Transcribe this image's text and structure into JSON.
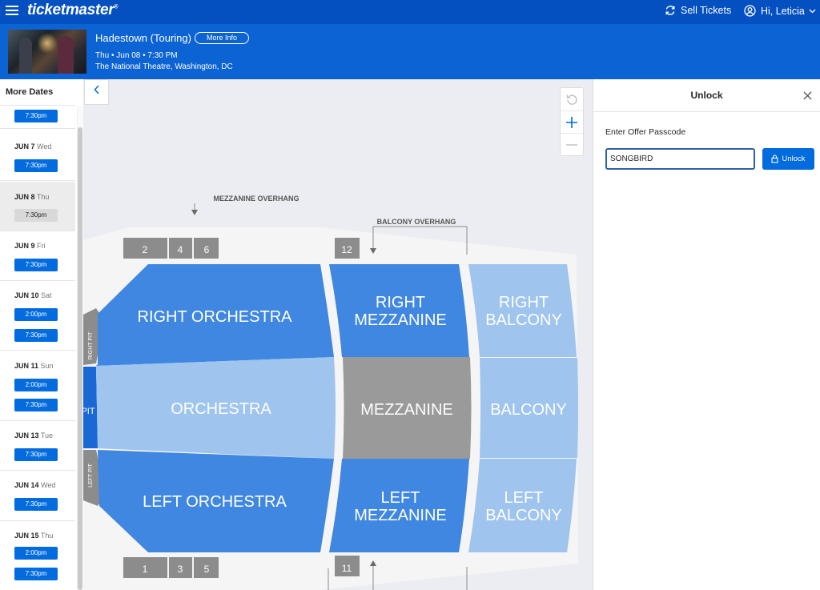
{
  "topbar": {
    "logo": "ticketmaster",
    "sell_tickets": "Sell Tickets",
    "user_greeting": "Hi, Leticia"
  },
  "event": {
    "title": "Hadestown (Touring)",
    "more_info": "More Info",
    "date": "Thu • Jun 08 • 7:30 PM",
    "venue": "The National Theatre, Washington, DC"
  },
  "dates_panel": {
    "title": "More Dates",
    "groups": [
      {
        "date": "",
        "day": "",
        "times": [
          "7:30pm"
        ],
        "selected": false
      },
      {
        "date": "JUN 7",
        "day": "Wed",
        "times": [
          "7:30pm"
        ],
        "selected": false
      },
      {
        "date": "JUN 8",
        "day": "Thu",
        "times": [
          "7:30pm"
        ],
        "selected": true
      },
      {
        "date": "JUN 9",
        "day": "Fri",
        "times": [
          "7:30pm"
        ],
        "selected": false
      },
      {
        "date": "JUN 10",
        "day": "Sat",
        "times": [
          "2:00pm",
          "7:30pm"
        ],
        "selected": false
      },
      {
        "date": "JUN 11",
        "day": "Sun",
        "times": [
          "2:00pm",
          "7:30pm"
        ],
        "selected": false
      },
      {
        "date": "JUN 13",
        "day": "Tue",
        "times": [
          "7:30pm"
        ],
        "selected": false
      },
      {
        "date": "JUN 14",
        "day": "Wed",
        "times": [
          "7:30pm"
        ],
        "selected": false
      },
      {
        "date": "JUN 15",
        "day": "Thu",
        "times": [
          "2:00pm",
          "7:30pm"
        ],
        "selected": false
      }
    ]
  },
  "seatmap": {
    "overhang_mezz": "MEZZANINE OVERHANG",
    "overhang_balc": "BALCONY OVERHANG",
    "boxes_top": [
      "2",
      "4",
      "6"
    ],
    "box_top_single": "12",
    "boxes_bottom": [
      "1",
      "3",
      "5"
    ],
    "box_bottom_single": "11",
    "sections": {
      "right_orchestra": "RIGHT ORCHESTRA",
      "orchestra": "ORCHESTRA",
      "left_orchestra": "LEFT ORCHESTRA",
      "right_mezzanine_1": "RIGHT",
      "right_mezzanine_2": "MEZZANINE",
      "mezzanine": "MEZZANINE",
      "left_mezzanine_1": "LEFT",
      "left_mezzanine_2": "MEZZANINE",
      "right_balcony_1": "RIGHT",
      "right_balcony_2": "BALCONY",
      "balcony": "BALCONY",
      "left_balcony_1": "LEFT",
      "left_balcony_2": "BALCONY",
      "right_pit": "RIGHT PIT",
      "pit": "PIT",
      "left_pit": "LEFT PIT"
    },
    "colors": {
      "dark_blue": "#3f87e0",
      "light_blue": "#9fc4ee",
      "unavailable": "#9a9a9a",
      "pit_blue": "#1a68d6"
    }
  },
  "unlock_panel": {
    "title": "Unlock",
    "label": "Enter Offer Passcode",
    "passcode_value": "SONGBIRD",
    "button": "Unlock"
  }
}
